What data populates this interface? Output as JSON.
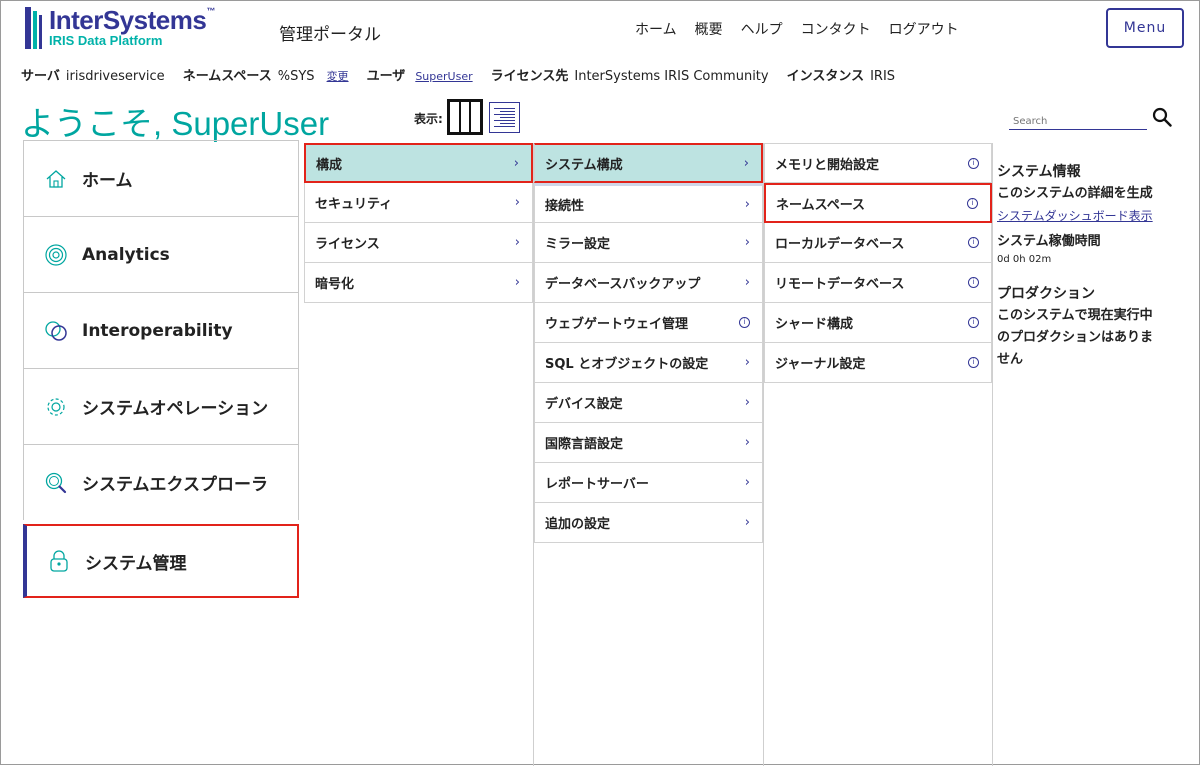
{
  "header": {
    "logo_name": "InterSystems",
    "logo_tm": "™",
    "logo_sub": "IRIS Data Platform",
    "portal_title": "管理ポータル",
    "nav": [
      "ホーム",
      "概要",
      "ヘルプ",
      "コンタクト",
      "ログアウト"
    ],
    "menu_label": "Menu"
  },
  "infobar": {
    "server_label": "サーバ",
    "server_value": "irisdriveservice",
    "namespace_label": "ネームスペース",
    "namespace_value": "%SYS",
    "change_link": "変更",
    "user_label": "ユーザ",
    "user_value": "SuperUser",
    "license_label": "ライセンス先",
    "license_value": "InterSystems IRIS Community",
    "instance_label": "インスタンス",
    "instance_value": "IRIS"
  },
  "welcome": "ようこそ, SuperUser",
  "view": {
    "label": "表示:"
  },
  "search": {
    "placeholder": "Search"
  },
  "leftnav": [
    {
      "label": "ホーム",
      "icon": "home-icon"
    },
    {
      "label": "Analytics",
      "icon": "analytics-icon"
    },
    {
      "label": "Interoperability",
      "icon": "interoperability-icon"
    },
    {
      "label": "システムオペレーション",
      "icon": "gear-icon"
    },
    {
      "label": "システムエクスプローラ",
      "icon": "explorer-icon"
    },
    {
      "label": "システム管理",
      "icon": "lock-icon"
    }
  ],
  "col1": [
    "構成",
    "セキュリティ",
    "ライセンス",
    "暗号化"
  ],
  "col2": [
    "システム構成",
    "接続性",
    "ミラー設定",
    "データベースバックアップ",
    "ウェブゲートウェイ管理",
    "SQL とオブジェクトの設定",
    "デバイス設定",
    "国際言語設定",
    "レポートサーバー",
    "追加の設定"
  ],
  "col3": [
    "メモリと開始設定",
    "ネームスペース",
    "ローカルデータベース",
    "リモートデータベース",
    "シャード構成",
    "ジャーナル設定"
  ],
  "rpanel": {
    "sysinfo_title": "システム情報",
    "sysinfo_text": "このシステムの詳細を生成",
    "dashboard_link": "システムダッシュボード表示",
    "uptime_title": "システム稼働時間",
    "uptime_value": "0d 0h 02m",
    "production_title": "プロダクション",
    "production_text": "このシステムで現在実行中のプロダクションはありません"
  },
  "colors": {
    "brand": "#333695",
    "accent": "#00b2a9",
    "highlight": "#e2231a",
    "selected_bg": "#bde3e1"
  }
}
